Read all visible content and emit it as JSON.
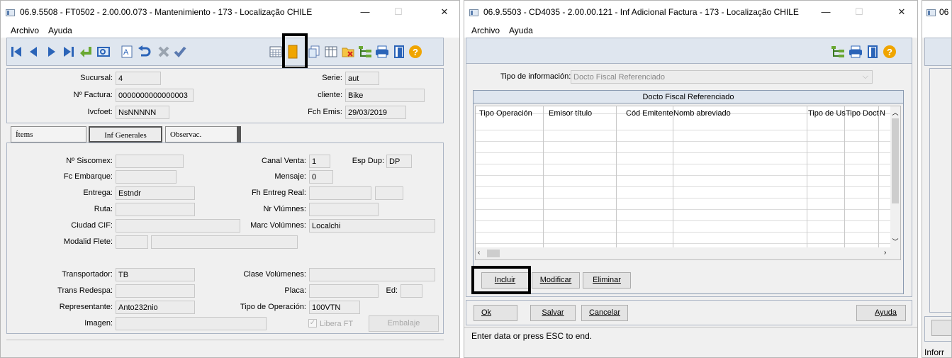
{
  "window1": {
    "title": "06.9.5508 - FT0502 - 2.00.00.073 - Mantenimiento - 173 - Localização CHILE",
    "menu": [
      "Archivo",
      "Ayuda"
    ],
    "header": {
      "sucursal_label": "Sucursal:",
      "sucursal_value": "4",
      "serie_label": "Serie:",
      "serie_value": "aut",
      "nfactura_label": "Nº Factura:",
      "nfactura_value": "0000000000000003",
      "cliente_label": "cliente:",
      "cliente_value": "Bike",
      "ivcfoet_label": "Ivcfoet:",
      "ivcfoet_value": "NsNNNNN",
      "fchemis_label": "Fch Emis:",
      "fchemis_value": "29/03/2019"
    },
    "tabs": [
      "Ítems",
      "Inf Generales",
      "Observac."
    ],
    "fields": {
      "nsiscomex_label": "Nº Siscomex:",
      "canal_label": "Canal Venta:",
      "canal_value": "1",
      "espdup_label": "Esp Dup:",
      "espdup_value": "DP",
      "fcembarque_label": "Fc Embarque:",
      "mensaje_label": "Mensaje:",
      "mensaje_value": "0",
      "entrega_label": "Entrega:",
      "entrega_value": "Estndr",
      "fhentreg_label": "Fh Entreg Real:",
      "ruta_label": "Ruta:",
      "nrvlumnes_label": "Nr Vlúmnes:",
      "ciudad_label": "Ciudad CIF:",
      "marc_label": "Marc Volúmnes:",
      "marc_value": "Localchi",
      "modalid_label": "Modalid Flete:",
      "transportador_label": "Transportador:",
      "transportador_value": "TB",
      "clase_label": "Clase Volúmenes:",
      "transredespa_label": "Trans Redespa:",
      "placa_label": "Placa:",
      "ed_label": "Ed:",
      "representante_label": "Representante:",
      "representante_value": "Anto232nio",
      "tipoop_label": "Tipo de Operación:",
      "tipoop_value": "100VTN",
      "imagen_label": "Imagen:",
      "libera_label": "Libera FT",
      "embalaje_label": "Embalaje"
    }
  },
  "window2": {
    "title": "06.9.5503 - CD4035 - 2.00.00.121 - Inf Adicional Factura - 173 - Localização CHILE",
    "menu": [
      "Archivo",
      "Ayuda"
    ],
    "tipo_label": "Tipo de información:",
    "tipo_value": "Docto Fiscal Referenciado",
    "grid_title": "Docto Fiscal Referenciado",
    "columns": [
      "Tipo Operación",
      "Emisor título",
      "Cód Emitente",
      "Nomb abreviado",
      "Tipo de Us",
      "Tipo Doct",
      "N"
    ],
    "buttons": {
      "incluir": "Incluir",
      "modificar": "Modificar",
      "eliminar": "Eliminar"
    },
    "footer_buttons": {
      "ok": "Ok",
      "salvar": "Salvar",
      "cancelar": "Cancelar",
      "ayuda": "Ayuda"
    },
    "status": "Enter data or press ESC to end."
  },
  "window3": {
    "title_fragment": "06",
    "status_fragment": "Inforr"
  },
  "colors": {
    "accent_blue": "#2b64b8",
    "highlight_border": "#000000",
    "title_icon_blue": "#5b7fb0"
  }
}
